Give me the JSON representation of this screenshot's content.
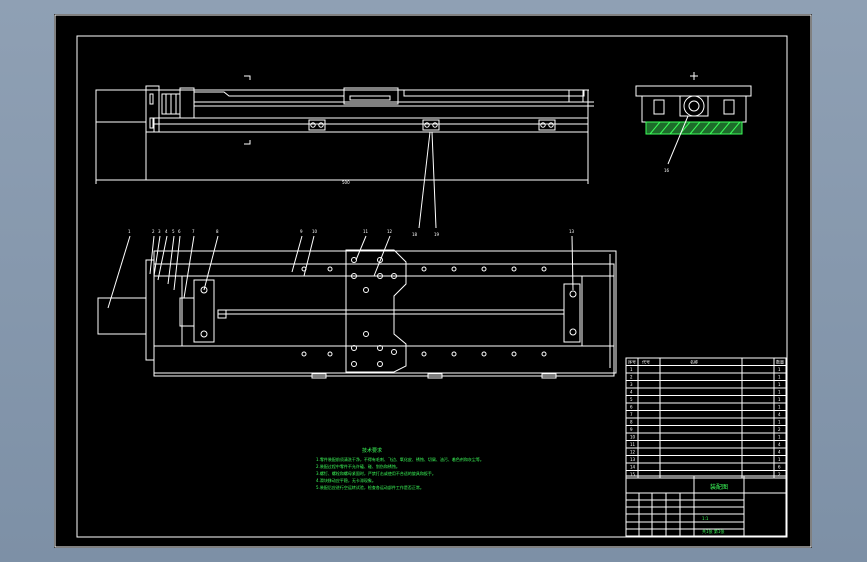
{
  "drawing": {
    "part_numbers_top": [
      "1",
      "2",
      "3",
      "4",
      "5",
      "6",
      "7",
      "8",
      "9",
      "10",
      "11",
      "12",
      "13",
      "14",
      "15",
      "16",
      "17"
    ],
    "leader_labels_mid": [
      "18",
      "19"
    ],
    "leader_label_side": "16",
    "dim_top": "500",
    "tech_title": "技术要求",
    "tech_notes": [
      "1.零件装配前须清洗干净，不得有毛刺、飞边、氧化皮、锈蚀、切屑、油污、着色剂和灰尘等。",
      "2.装配过程中零件不允许磕、碰、划伤和锈蚀。",
      "3.螺钉、螺栓和螺母紧固时，严禁打击或使用不合适的旋具和扳手。",
      "4.滑块移动应平稳，无卡滞现象。",
      "5.装配后应进行空运转试验，检查各运动部件工作是否正常。"
    ],
    "bom": {
      "headers": [
        "序号",
        "代号",
        "名称",
        "数量"
      ],
      "rows": [
        [
          "1",
          "",
          "",
          "1"
        ],
        [
          "2",
          "",
          "",
          "1"
        ],
        [
          "3",
          "",
          "",
          "1"
        ],
        [
          "4",
          "",
          "",
          "1"
        ],
        [
          "5",
          "",
          "",
          "1"
        ],
        [
          "6",
          "",
          "",
          "1"
        ],
        [
          "7",
          "",
          "",
          "4"
        ],
        [
          "8",
          "",
          "",
          "1"
        ],
        [
          "9",
          "",
          "",
          "2"
        ],
        [
          "10",
          "",
          "",
          "1"
        ],
        [
          "11",
          "",
          "",
          "4"
        ],
        [
          "12",
          "",
          "",
          "4"
        ],
        [
          "13",
          "",
          "",
          "1"
        ],
        [
          "14",
          "",
          "",
          "6"
        ],
        [
          "15",
          "",
          "",
          "2"
        ]
      ]
    },
    "title_block": {
      "drawing_name": "装配图",
      "drawing_no": "",
      "scale": "1:1",
      "sheet": "共1张 第1张"
    }
  }
}
